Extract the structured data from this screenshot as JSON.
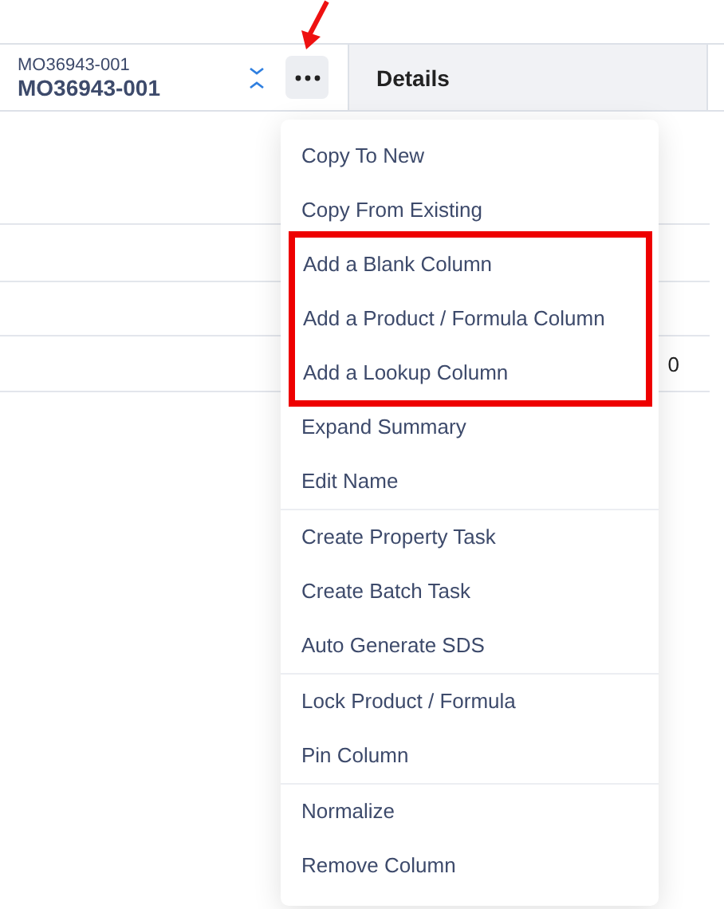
{
  "column_header": {
    "subtitle": "MO36943-001",
    "title": "MO36943-001"
  },
  "details_panel": {
    "title": "Details"
  },
  "table": {
    "cell_value": "0"
  },
  "menu": {
    "sections": [
      {
        "divided": false,
        "boxed": false,
        "items": [
          "Copy To New",
          "Copy From Existing"
        ]
      },
      {
        "divided": false,
        "boxed": true,
        "items": [
          "Add a Blank Column",
          "Add a Product / Formula Column",
          "Add a Lookup Column"
        ]
      },
      {
        "divided": false,
        "boxed": false,
        "items": [
          "Expand Summary",
          "Edit Name"
        ]
      },
      {
        "divided": true,
        "boxed": false,
        "items": [
          "Create Property Task",
          "Create Batch Task",
          "Auto Generate SDS"
        ]
      },
      {
        "divided": true,
        "boxed": false,
        "items": [
          "Lock Product / Formula",
          "Pin Column"
        ]
      },
      {
        "divided": true,
        "boxed": false,
        "items": [
          "Normalize",
          "Remove Column"
        ]
      }
    ]
  }
}
